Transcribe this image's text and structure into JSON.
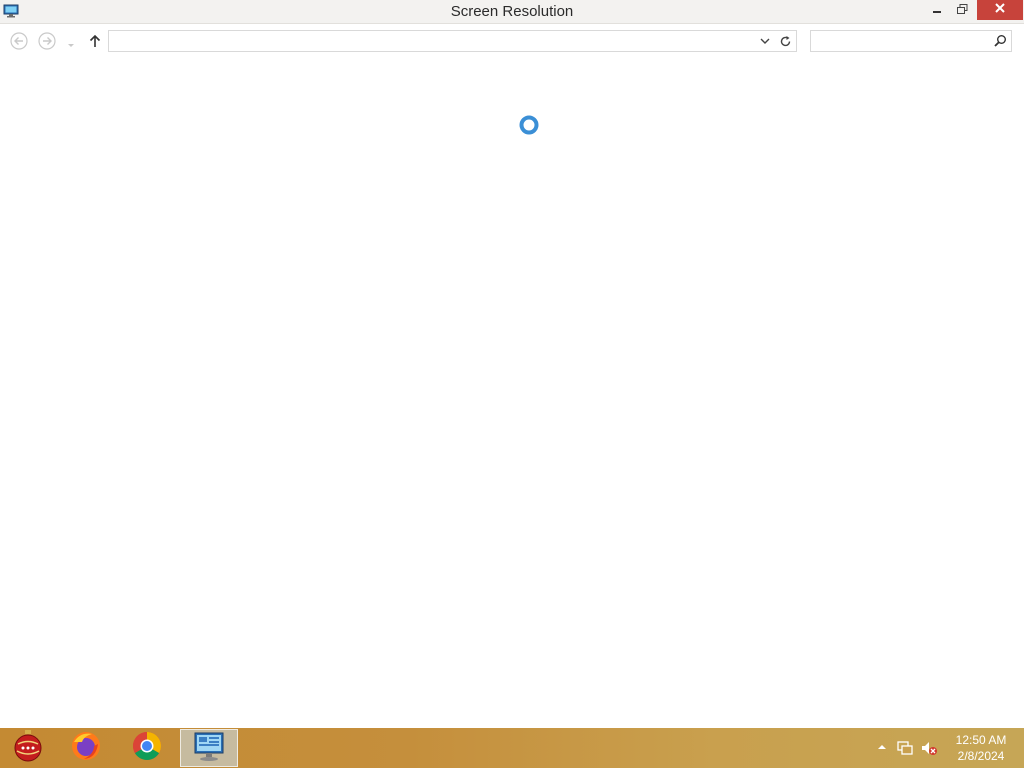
{
  "window": {
    "title": "Screen Resolution",
    "app_icon": "display-settings-icon",
    "controls": {
      "minimize_icon": "minimize-icon",
      "restore_icon": "restore-icon",
      "close_icon": "close-icon",
      "close_color": "#c7433b"
    }
  },
  "navbar": {
    "back_icon": "back-arrow-icon",
    "forward_icon": "forward-arrow-icon",
    "recent_icon": "chevron-down-icon",
    "up_icon": "up-arrow-icon",
    "address_value": "",
    "address_dropdown_icon": "chevron-down-icon",
    "refresh_icon": "refresh-icon",
    "search_value": "",
    "search_icon": "search-icon"
  },
  "content": {
    "state": "loading",
    "spinner_icon": "loading-spinner-icon",
    "spinner_color": "#3b8fd6"
  },
  "taskbar": {
    "apps": [
      {
        "name": "christmas-ornament-app",
        "icon": "ornament-icon",
        "active": false
      },
      {
        "name": "firefox",
        "icon": "firefox-icon",
        "active": false
      },
      {
        "name": "chrome",
        "icon": "chrome-icon",
        "active": false
      },
      {
        "name": "control-panel",
        "icon": "control-panel-icon",
        "active": true
      }
    ],
    "tray": {
      "show_hidden_icon": "chevron-up-icon",
      "network_icon": "network-icon",
      "volume_icon": "volume-muted-icon"
    },
    "clock": {
      "time": "12:50 AM",
      "date": "2/8/2024"
    }
  }
}
